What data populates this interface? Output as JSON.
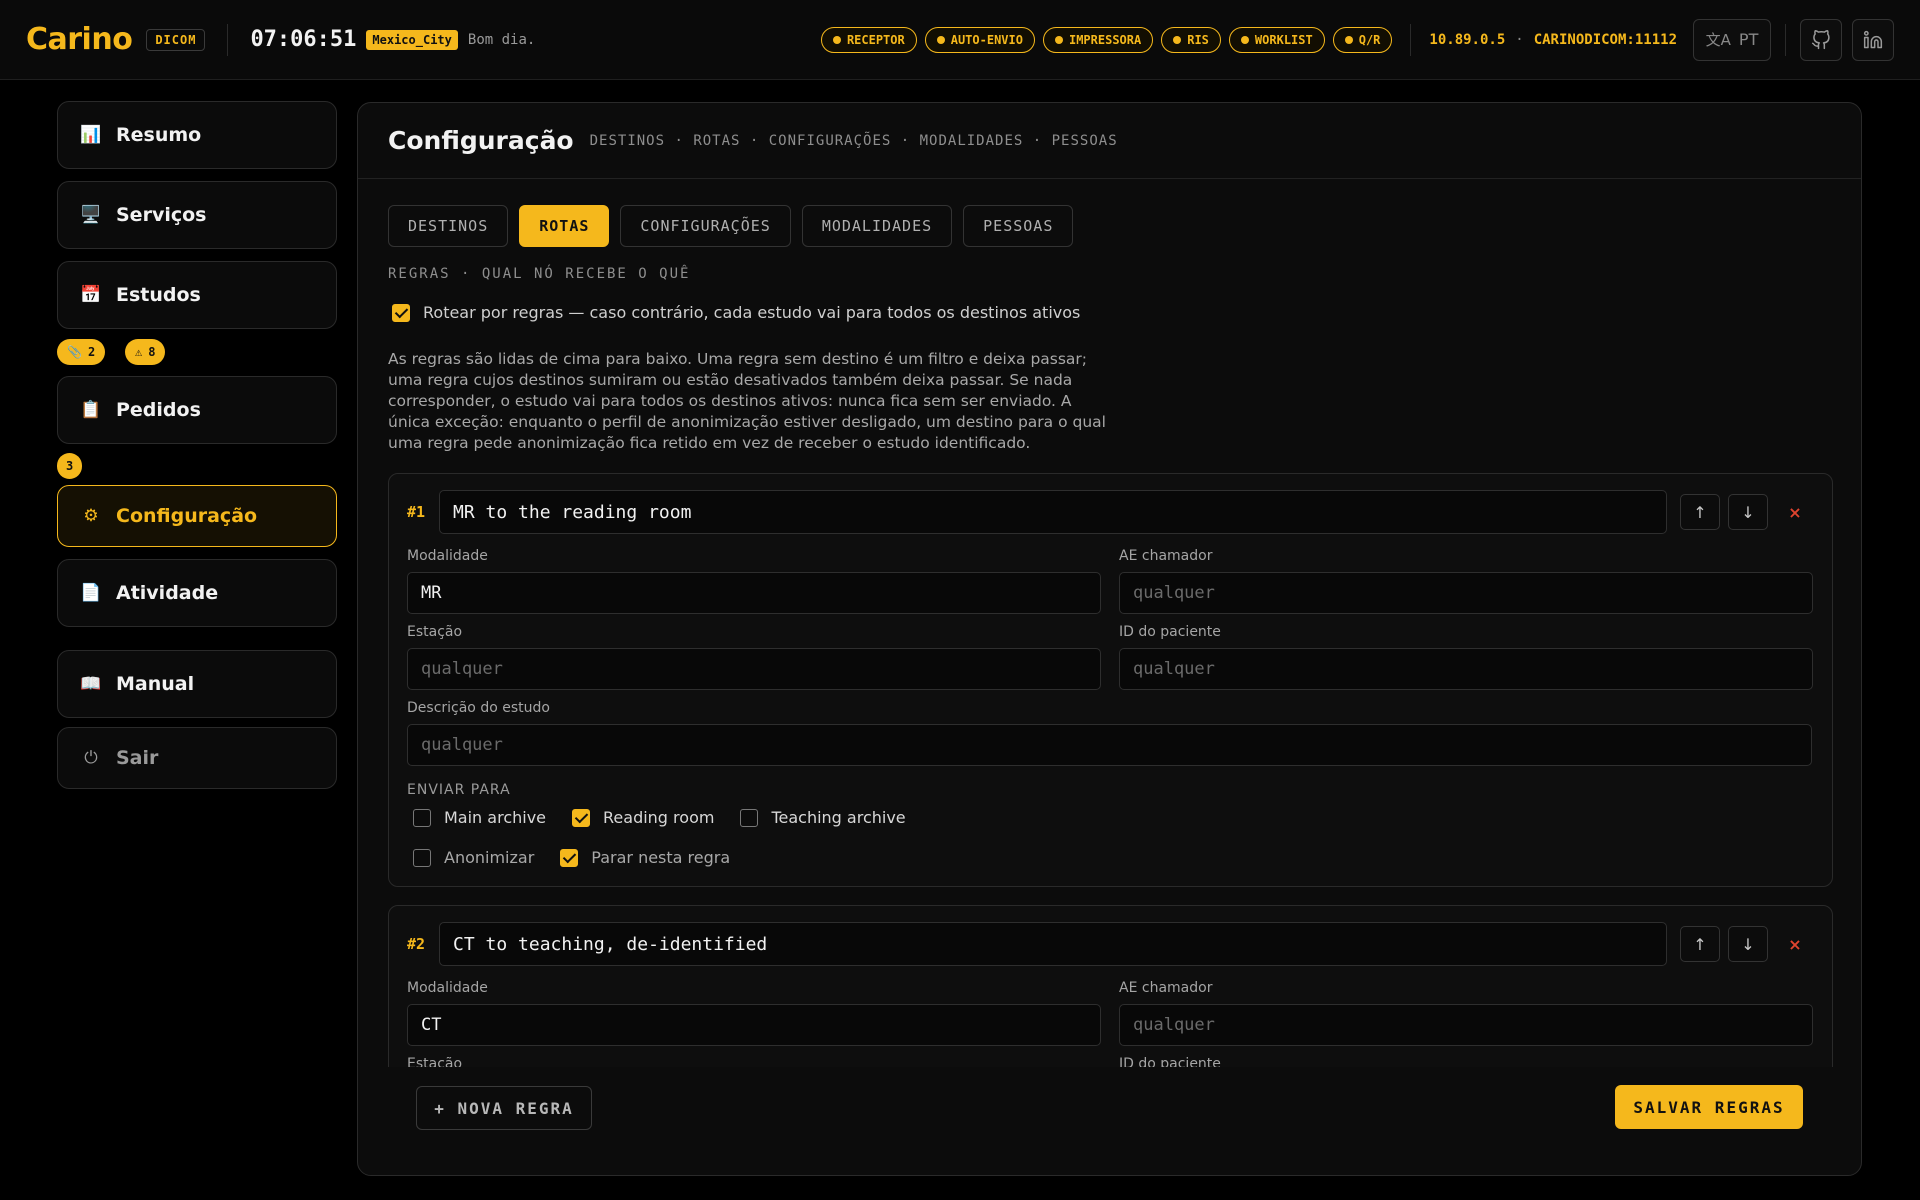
{
  "header": {
    "logo": "Carino",
    "product_tag": "DICOM",
    "clock": "07:06:51",
    "timezone": "Mexico_City",
    "greeting": "Bom dia.",
    "status_pills": [
      {
        "label": "RECEPTOR"
      },
      {
        "label": "AUTO-ENVIO"
      },
      {
        "label": "IMPRESSORA"
      },
      {
        "label": "RIS"
      },
      {
        "label": "WORKLIST"
      },
      {
        "label": "Q/R"
      }
    ],
    "ip": "10.89.0.5",
    "separator": "·",
    "ae_port": "CARINODICOM:11112",
    "language": "PT",
    "icons": {
      "translate": "translate-icon",
      "github": "github-icon",
      "linkedin": "linkedin-icon"
    },
    "accent_color": "#f5b81c"
  },
  "sidebar": {
    "items": [
      {
        "label": "Resumo",
        "icon": "📊"
      },
      {
        "label": "Serviços",
        "icon": "🖥️"
      },
      {
        "label": "Estudos",
        "icon": "📅"
      },
      {
        "label": "Pedidos",
        "icon": "📋"
      },
      {
        "label": "Configuração",
        "icon": "⚙"
      },
      {
        "label": "Atividade",
        "icon": "📄"
      },
      {
        "label": "Manual",
        "icon": "📖"
      },
      {
        "label": "Sair",
        "icon": "⏻"
      }
    ],
    "estudos_badges": [
      {
        "icon": "📎",
        "count": "2"
      },
      {
        "icon": "⚠",
        "count": "8"
      }
    ],
    "pedidos_badge": "3"
  },
  "main": {
    "title": "Configuração",
    "breadcrumb": "DESTINOS · ROTAS · CONFIGURAÇÕES · MODALIDADES · PESSOAS",
    "tabs": [
      {
        "label": "DESTINOS",
        "active": false
      },
      {
        "label": "ROTAS",
        "active": true
      },
      {
        "label": "CONFIGURAÇÕES",
        "active": false
      },
      {
        "label": "MODALIDADES",
        "active": false
      },
      {
        "label": "PESSOAS",
        "active": false
      }
    ],
    "section_label": "REGRAS · QUAL NÓ RECEBE O QUÊ",
    "route_by_rules": {
      "checked": true,
      "label": "Rotear por regras — caso contrário, cada estudo vai para todos os destinos ativos"
    },
    "description": "As regras são lidas de cima para baixo. Uma regra sem destino é um filtro e deixa passar; uma regra cujos destinos sumiram ou estão desativados também deixa passar. Se nada corresponder, o estudo vai para todos os destinos ativos: nunca fica sem ser enviado. A única exceção: enquanto o perfil de anonimização estiver desligado, um destino para o qual uma regra pede anonimização fica retido em vez de receber o estudo identificado.",
    "field_labels": {
      "modality": "Modalidade",
      "calling_ae": "AE chamador",
      "station": "Estação",
      "patient_id": "ID do paciente",
      "study_desc": "Descrição do estudo",
      "send_to": "ENVIAR PARA"
    },
    "placeholder": "qualquer",
    "rules": [
      {
        "number": "#1",
        "name": "MR to the reading room",
        "modality": "MR",
        "calling_ae": "",
        "station": "",
        "patient_id": "",
        "study_desc": "",
        "destinations": [
          {
            "label": "Main archive",
            "checked": false
          },
          {
            "label": "Reading room",
            "checked": true
          },
          {
            "label": "Teaching archive",
            "checked": false
          }
        ],
        "anonymize": {
          "label": "Anonimizar",
          "checked": false
        },
        "stop": {
          "label": "Parar nesta regra",
          "checked": true
        }
      },
      {
        "number": "#2",
        "name": "CT to teaching, de-identified",
        "modality": "CT",
        "calling_ae": ""
      }
    ],
    "rule_controls": {
      "up": "↑",
      "down": "↓",
      "delete": "×"
    },
    "new_rule_label": "+ NOVA REGRA",
    "save_rules_label": "SALVAR REGRAS"
  }
}
